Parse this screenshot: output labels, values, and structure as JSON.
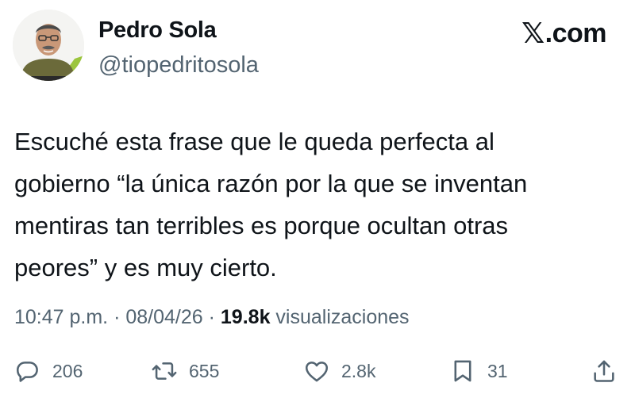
{
  "author": {
    "display_name": "Pedro Sola",
    "handle": "@tiopedritosola"
  },
  "brand": {
    "icon": "x-logo-icon",
    "label": ".com"
  },
  "tweet": {
    "text": "Escuché esta frase que le queda perfecta al\ngobierno “la única razón por la que se inventan\nmentiras tan terribles es porque ocultan otras\npeores” y es muy cierto.",
    "time": "10:47 p.m.",
    "sep1": " · ",
    "date": "08/04/26",
    "sep2": " · ",
    "views_count": "19.8k",
    "views_label": " visualizaciones"
  },
  "actions": {
    "replies": {
      "icon": "reply-icon",
      "count": "206"
    },
    "reposts": {
      "icon": "repost-icon",
      "count": "655"
    },
    "likes": {
      "icon": "heart-icon",
      "count": "2.8k"
    },
    "bookmarks": {
      "icon": "bookmark-icon",
      "count": "31"
    },
    "share": {
      "icon": "share-icon"
    }
  },
  "colors": {
    "text": "#0f1419",
    "secondary": "#536471",
    "background": "#ffffff"
  }
}
